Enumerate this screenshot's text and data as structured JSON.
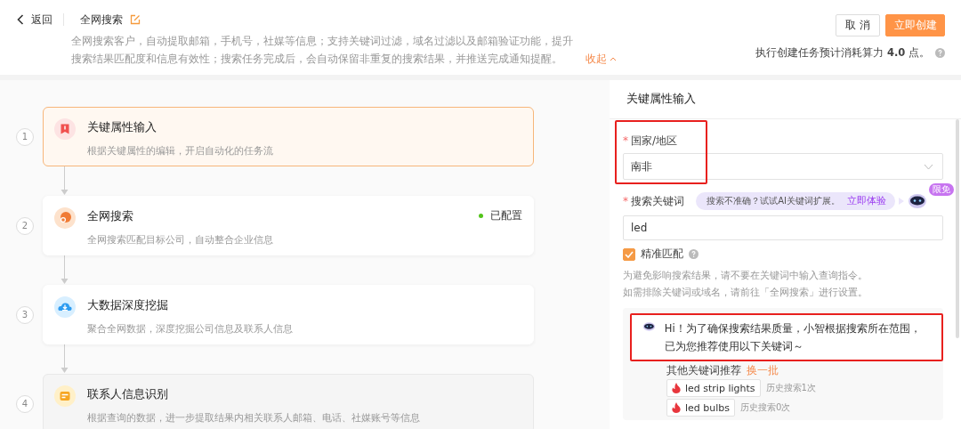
{
  "header": {
    "back": "返回",
    "title": "全网搜索",
    "description": "全网搜索客户，自动提取邮箱，手机号，社媒等信息；支持关键词过滤，域名过滤以及邮箱验证功能，提升搜索结果匹配度和信息有效性；搜索任务完成后，会自动保留非重复的搜索结果，并推送完成通知提醒。",
    "collapse": "收起",
    "buttons": [
      {
        "label": "取 消",
        "kind": "secondary"
      },
      {
        "label": "立即创建",
        "kind": "primary"
      }
    ],
    "cost_note": "执行创建任务预计消耗算力 **4.0** 点。"
  },
  "steps": [
    {
      "number": "1",
      "title": "关键属性输入",
      "description": "根据关键属性的编辑，开启自动化的任务流",
      "selected": true,
      "disabled": false,
      "kind": "bookmark"
    },
    {
      "number": "2",
      "title": "全网搜索",
      "description": "全网搜索匹配目标公司，自动整合企业信息",
      "selected": false,
      "disabled": false,
      "kind": "search",
      "status": "已配置"
    },
    {
      "number": "3",
      "title": "大数据深度挖掘",
      "description": "聚合全网数据，深度挖掘公司信息及联系人信息",
      "selected": false,
      "disabled": false,
      "kind": "download"
    },
    {
      "number": "4",
      "title": "联系人信息识别",
      "description": "根据查询的数据，进一步提取结果内相关联系人邮箱、电话、社媒账号等信息",
      "selected": false,
      "disabled": true,
      "kind": "card"
    }
  ],
  "panel": {
    "title": "关键属性输入",
    "country": {
      "label": "国家/地区",
      "value": "南非",
      "required_mark": "*",
      "highlighted": true
    },
    "keyword": {
      "label": "搜索关键词",
      "value": "led",
      "required_mark": "*"
    },
    "ai_tip": {
      "text": "搜索不准确？试试AI关键词扩展。",
      "link": "立即体验",
      "badge": "限免"
    },
    "exact_match": {
      "label": "精准匹配",
      "checked": true
    },
    "notes": [
      "为避免影响搜索结果，请不要在关键词中输入查询指令。",
      "如需排除关键词或域名，请前往「全网搜索」进行设置。"
    ],
    "assistant": {
      "message": "Hi！为了确保搜索结果质量，小智根据搜索所在范围，已为您推荐使用以下关键词～",
      "highlighted": true,
      "other_label": "其他关键词推荐",
      "refresh": "换一批",
      "suggestions": [
        {
          "keyword": "led strip lights",
          "history": "历史搜索1次"
        },
        {
          "keyword": "led bulbs",
          "history": "历史搜索0次"
        }
      ]
    }
  }
}
